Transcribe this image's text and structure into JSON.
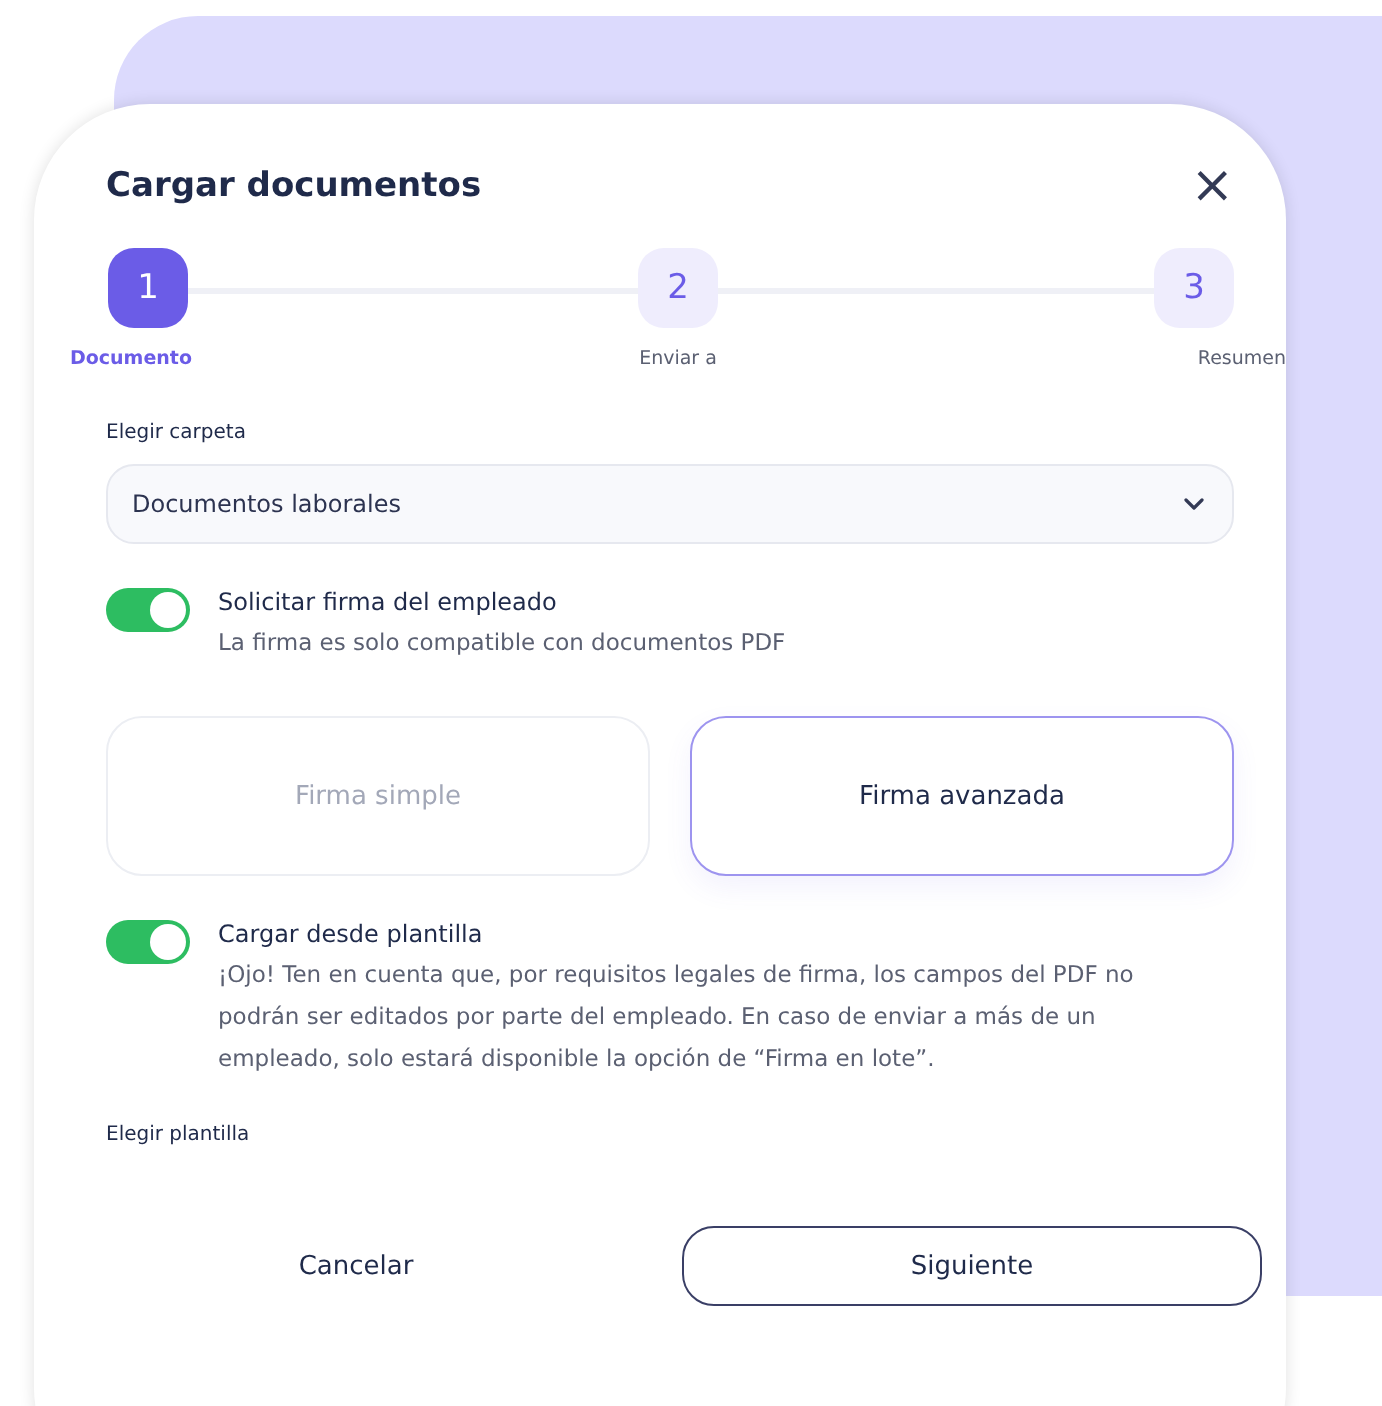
{
  "dialog": {
    "title": "Cargar documentos",
    "close": "×"
  },
  "steps": [
    {
      "number": "1",
      "label": "Documento",
      "selected": true
    },
    {
      "number": "2",
      "label": "Enviar a",
      "selected": false
    },
    {
      "number": "3",
      "label": "Resumen",
      "selected": false
    }
  ],
  "folder": {
    "label": "Elegir carpeta",
    "value": "Documentos laborales"
  },
  "signature_toggle": {
    "label": "Solicitar firma del empleado",
    "hint": "La firma es solo compatible con documentos PDF",
    "on": true
  },
  "signature_options": [
    {
      "label": "Firma simple",
      "selected": false
    },
    {
      "label": "Firma avanzada",
      "selected": true
    }
  ],
  "template_toggle": {
    "label": "Cargar desde plantilla",
    "hint": "¡Ojo! Ten en cuenta que, por requisitos legales de firma, los campos del PDF no podrán ser editados por parte del empleado. En caso de enviar a más de un empleado, solo estará disponible la opción de “Firma en lote”.",
    "on": true
  },
  "template": {
    "label": "Elegir plantilla"
  },
  "buttons": [
    {
      "label": "Cancelar",
      "kind": "secondary"
    },
    {
      "label": "Siguiente",
      "kind": "primary"
    }
  ]
}
